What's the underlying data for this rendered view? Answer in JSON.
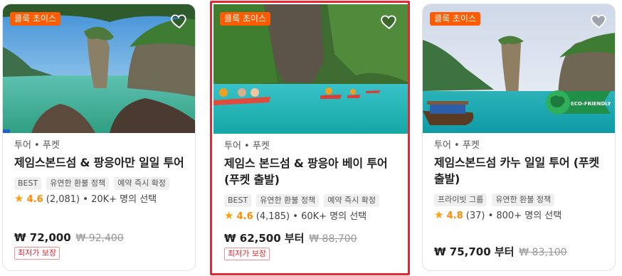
{
  "colors": {
    "badge": "#ff5b00",
    "highlight_border": "#e8262f",
    "star": "#ff9f0a",
    "strike": "#999999"
  },
  "cards": [
    {
      "badge": "클룩 초이스",
      "location": "투어 • 푸켓",
      "title": "제임스본드섬 & 팡응아만 일일 투어",
      "tags": [
        "BEST",
        "유연한 환불 정책",
        "예약 즉시 확정"
      ],
      "rating_value": "4.6",
      "review_count": "(2,081)",
      "booked": "• 20K+ 명의 선택",
      "price": "₩ 72,000",
      "old_price": "₩ 92,400",
      "lowest_price_label": "최저가 보장",
      "icons": [
        "heart-icon",
        "star-icon"
      ]
    },
    {
      "badge": "클룩 초이스",
      "location": "투어 • 푸켓",
      "title": "제임스 본드섬 & 팡응아 베이 투어 (푸켓 출발)",
      "tags": [
        "BEST",
        "유연한 환불 정책",
        "예약 즉시 확정"
      ],
      "rating_value": "4.6",
      "review_count": "(4,185)",
      "booked": "• 60K+ 명의 선택",
      "price": "₩ 62,500 부터",
      "old_price": "₩ 88,700",
      "lowest_price_label": "최저가 보장",
      "icons": [
        "heart-icon",
        "star-icon"
      ]
    },
    {
      "badge": "클룩 초이스",
      "location": "투어 • 푸켓",
      "title": "제임스본드섬 카누 일일 투어 (푸켓 출발)",
      "tags": [
        "프라이빗 그룹",
        "유연한 환불 정책"
      ],
      "rating_value": "4.8",
      "review_count": "(37)",
      "booked": "• 800+ 명의 선택",
      "price": "₩ 75,700 부터",
      "old_price": "₩ 83,100",
      "eco_logo_text": "ECO-FRIENDLY TOUR",
      "icons": [
        "heart-icon",
        "star-icon",
        "eco-friendly-logo"
      ]
    }
  ]
}
